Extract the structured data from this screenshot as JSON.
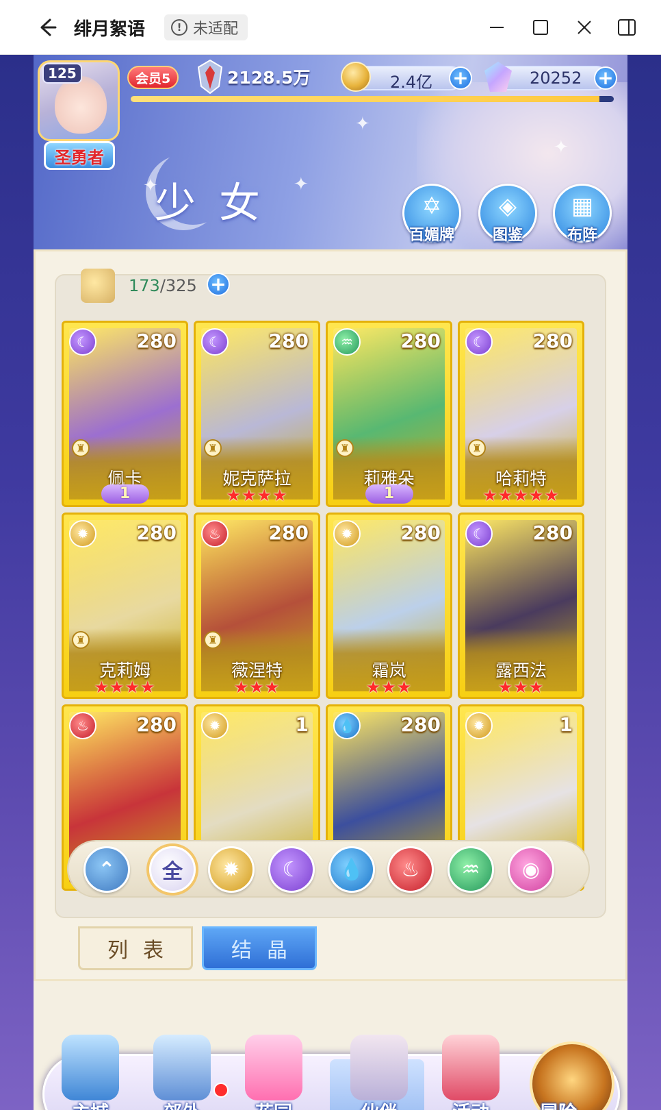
{
  "window": {
    "title": "绯月絮语",
    "compat_label": "未适配",
    "back_icon": "back-arrow-icon",
    "controls": [
      "minimize-icon",
      "maximize-icon",
      "close-icon",
      "sidebar-icon"
    ]
  },
  "hud": {
    "player_level": "125",
    "player_title": "圣勇者",
    "vip_label": "会员5",
    "power": "2128.5万",
    "gold": "2.4亿",
    "gems": "20252",
    "exp_progress": 0.97
  },
  "banner": {
    "section_title": "少女",
    "buttons": [
      {
        "label": "百媚牌",
        "icon": "card-deck-icon"
      },
      {
        "label": "图鉴",
        "icon": "codex-book-icon"
      },
      {
        "label": "布阵",
        "icon": "formation-grid-icon"
      }
    ]
  },
  "roster": {
    "count_current": "173",
    "count_sep": "/",
    "count_max": "325",
    "cards": [
      {
        "name": "佩卡",
        "level": "280",
        "element": "moon",
        "stars": "",
        "wing": "1",
        "art": "#9c6fd0"
      },
      {
        "name": "妮克萨拉",
        "level": "280",
        "element": "moon",
        "stars": "★★★★",
        "wing": "",
        "art": "#b9b8d6"
      },
      {
        "name": "莉雅朵",
        "level": "280",
        "element": "wind",
        "stars": "",
        "wing": "1",
        "art": "#58b872"
      },
      {
        "name": "哈莉特",
        "level": "280",
        "element": "moon",
        "stars": "★★★★★",
        "wing": "",
        "art": "#d7d0e8"
      },
      {
        "name": "克莉姆",
        "level": "280",
        "element": "sun",
        "stars": "★★★★",
        "wing": "",
        "art": "#e8d9a0"
      },
      {
        "name": "薇涅特",
        "level": "280",
        "element": "fire",
        "stars": "★★★",
        "wing": "",
        "art": "#b5503a"
      },
      {
        "name": "霜岚",
        "level": "280",
        "element": "sun",
        "stars": "★★★",
        "wing": "",
        "art": "#bcd0ea"
      },
      {
        "name": "露西法",
        "level": "280",
        "element": "moon",
        "stars": "★★★",
        "wing": "",
        "art": "#4a3b5e"
      },
      {
        "name": "",
        "level": "280",
        "element": "fire",
        "stars": "",
        "wing": "",
        "art": "#c8343a"
      },
      {
        "name": "",
        "level": "1",
        "element": "sun",
        "stars": "",
        "wing": "",
        "art": "#e3dcc2"
      },
      {
        "name": "",
        "level": "280",
        "element": "water",
        "stars": "",
        "wing": "",
        "art": "#3c4f9e"
      },
      {
        "name": "",
        "level": "1",
        "element": "sun",
        "stars": "",
        "wing": "",
        "art": "#e6e2e4"
      }
    ]
  },
  "filters": [
    {
      "id": "all-types",
      "label": "",
      "icon": "triangle-sort-icon"
    },
    {
      "id": "all",
      "label": "全",
      "icon": "all-filter-icon",
      "selected": true
    },
    {
      "id": "sun",
      "label": "",
      "icon": "sun-element-icon"
    },
    {
      "id": "moon",
      "label": "",
      "icon": "moon-element-icon"
    },
    {
      "id": "water",
      "label": "",
      "icon": "water-element-icon"
    },
    {
      "id": "fire",
      "label": "",
      "icon": "fire-element-icon"
    },
    {
      "id": "wind",
      "label": "",
      "icon": "wind-element-icon"
    },
    {
      "id": "heart",
      "label": "",
      "icon": "heart-element-icon"
    }
  ],
  "tabs": [
    {
      "label": "列表",
      "active": true
    },
    {
      "label": "结晶",
      "active": false
    }
  ],
  "bottom_nav": [
    {
      "label": "主城",
      "icon": "castle-icon"
    },
    {
      "label": "郊外",
      "icon": "portal-icon",
      "notification": true
    },
    {
      "label": "花园",
      "icon": "heart-garden-icon"
    },
    {
      "label": "伙伴",
      "icon": "partner-icon",
      "active": true
    },
    {
      "label": "活动",
      "icon": "gift-box-icon"
    },
    {
      "label": "冒险",
      "icon": "compass-icon"
    }
  ],
  "colors": {
    "accent_blue": "#2f6fd6",
    "card_gold": "#f7cf13",
    "star_red": "#ff2a2a",
    "notification_red": "#ff2d2d"
  }
}
